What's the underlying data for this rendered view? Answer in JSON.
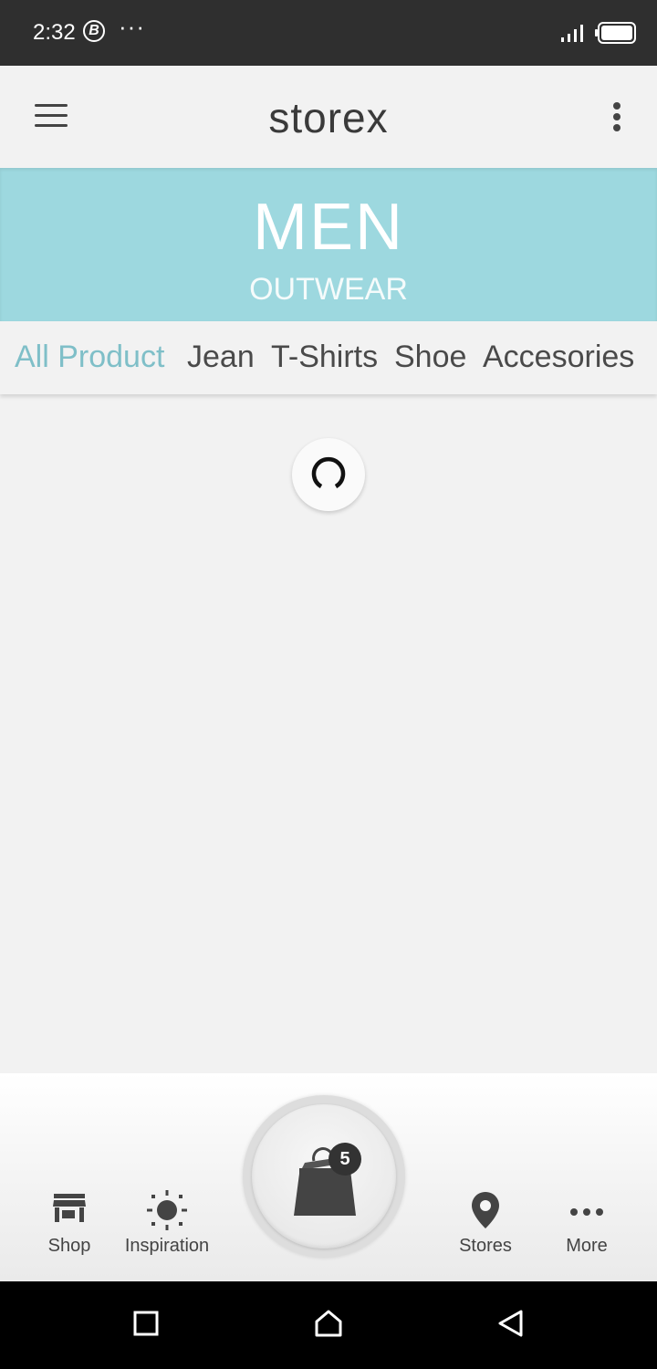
{
  "status_bar": {
    "time": "2:32",
    "notification_badge": "B",
    "more_dots": "···",
    "icons": [
      "signal-icon",
      "battery-icon"
    ]
  },
  "app_bar": {
    "title": "storex",
    "icons": [
      "menu-icon",
      "overflow-menu-icon"
    ]
  },
  "banner": {
    "title": "MEN",
    "subtitle": "OUTWEAR",
    "color": "#9dd8df"
  },
  "tabs": {
    "items": [
      {
        "label": "All Product",
        "active": true
      },
      {
        "label": "Jean",
        "active": false
      },
      {
        "label": "T-Shirts",
        "active": false
      },
      {
        "label": "Shoe",
        "active": false
      },
      {
        "label": "Accesories",
        "active": false
      }
    ],
    "active_color": "#7fbfc8"
  },
  "loading": {
    "icon": "spinner-icon"
  },
  "bottom_nav": {
    "items": [
      {
        "label": "Shop",
        "icon": "store-icon"
      },
      {
        "label": "Inspiration",
        "icon": "sun-icon"
      },
      {
        "label": "Stores",
        "icon": "location-pin-icon"
      },
      {
        "label": "More",
        "icon": "more-horizontal-icon"
      }
    ],
    "cart": {
      "icon": "shopping-bag-icon",
      "count": "5"
    }
  },
  "system_nav": {
    "icons": [
      "recents-square-icon",
      "home-icon",
      "back-triangle-icon"
    ]
  }
}
